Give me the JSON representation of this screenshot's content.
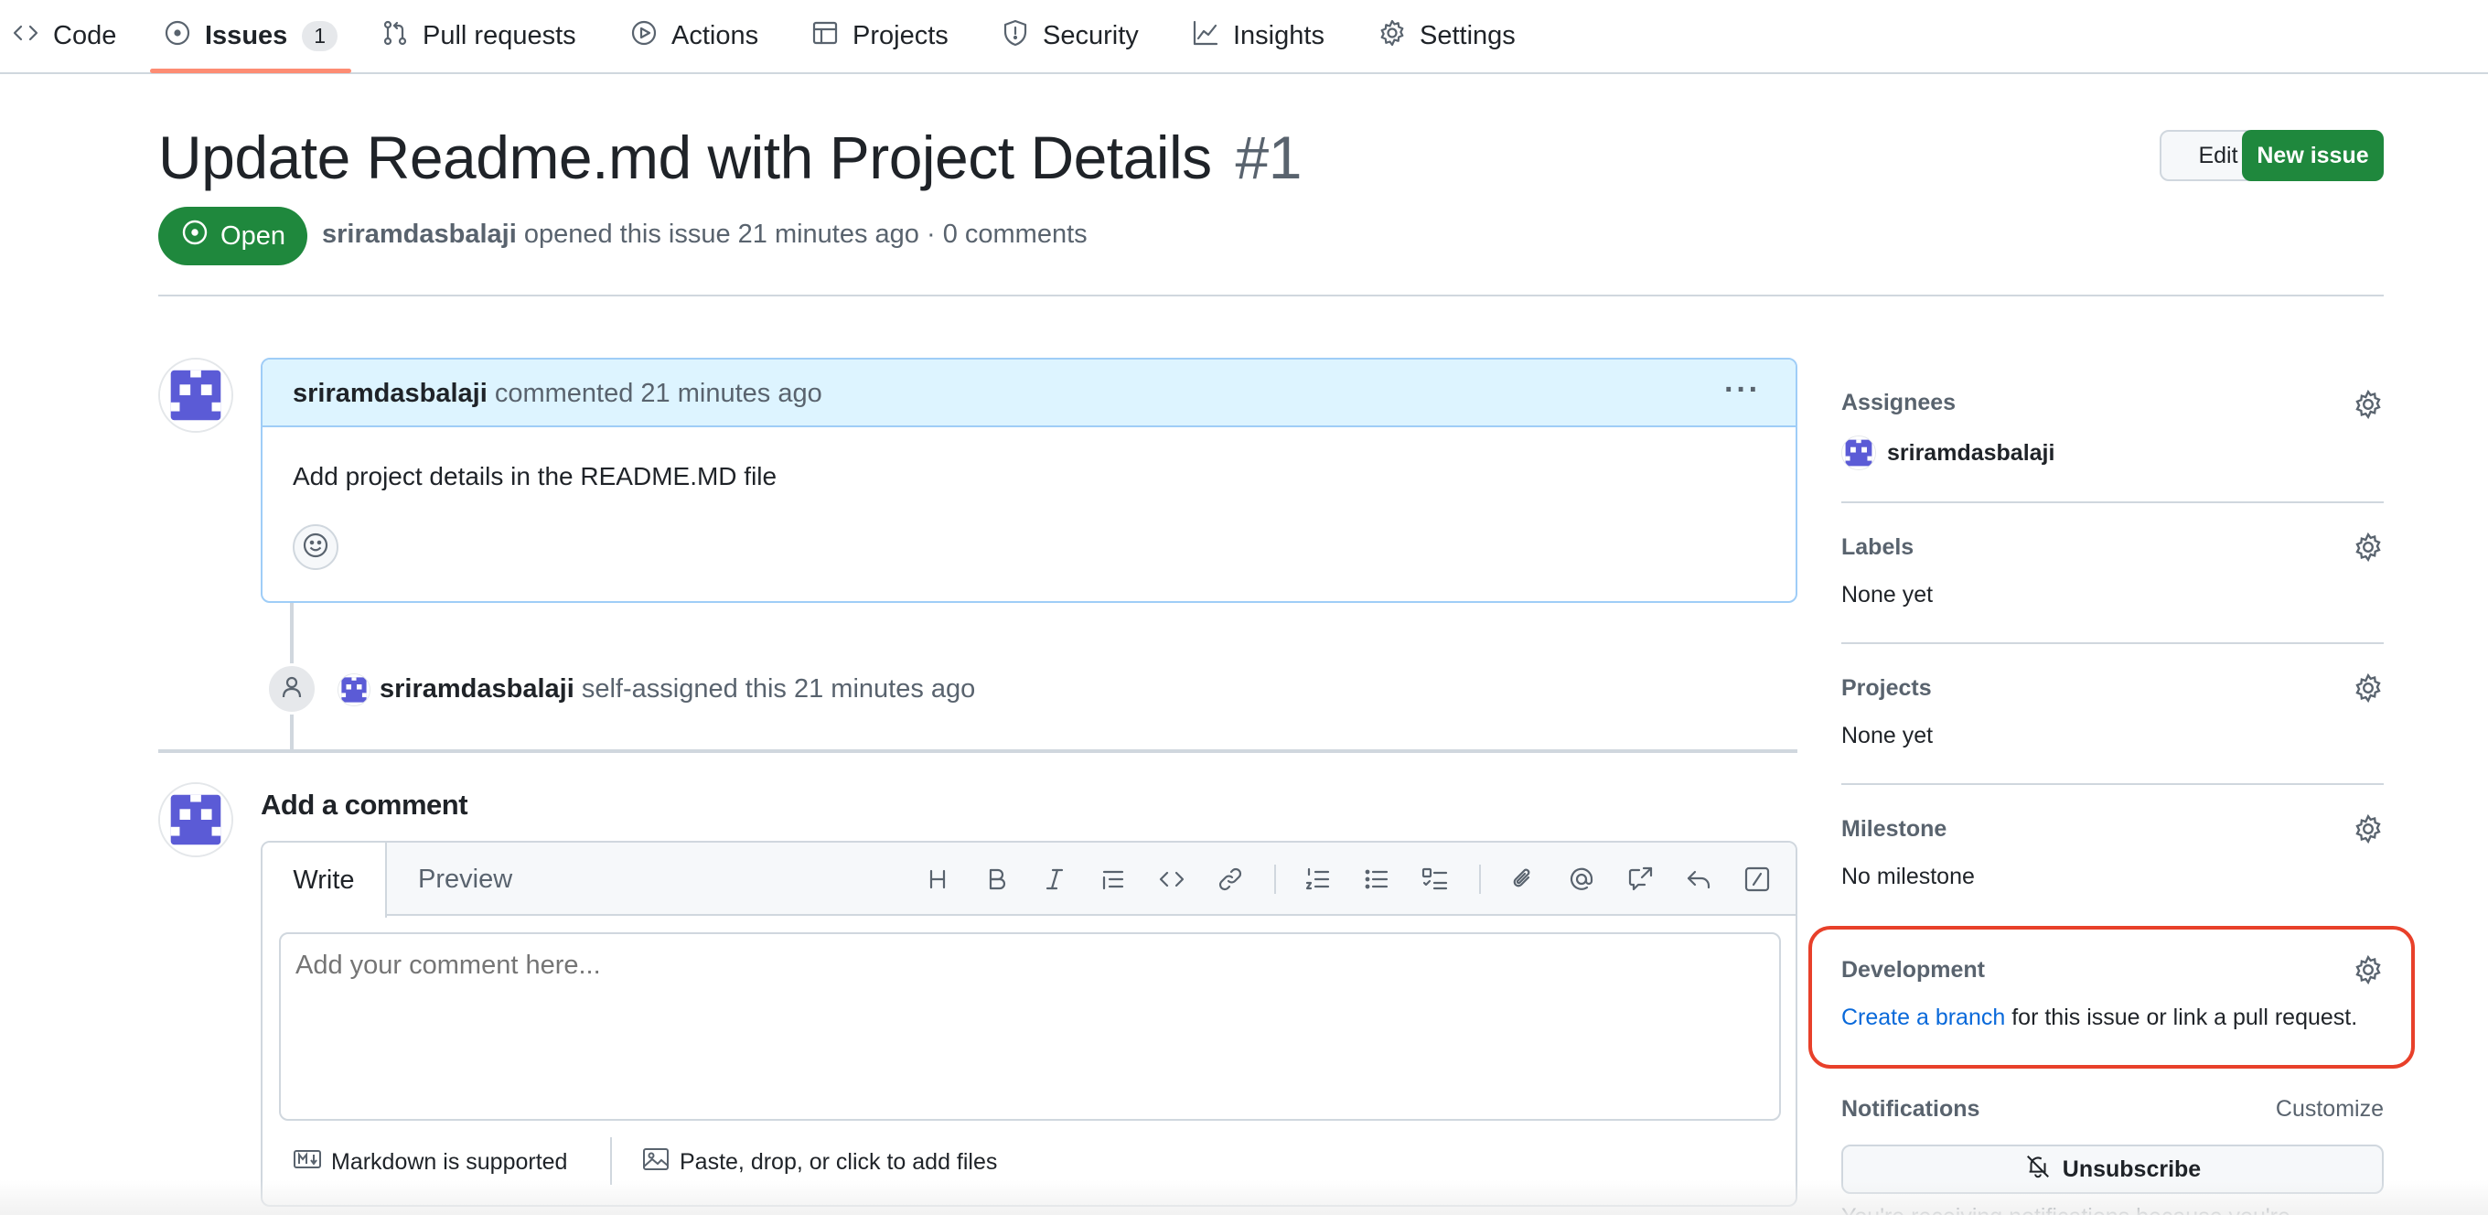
{
  "nav": {
    "tabs": [
      {
        "label": "Code",
        "icon": "code-icon"
      },
      {
        "label": "Issues",
        "icon": "issue-opened-icon",
        "counter": "1",
        "active": true
      },
      {
        "label": "Pull requests",
        "icon": "git-pull-request-icon"
      },
      {
        "label": "Actions",
        "icon": "play-icon"
      },
      {
        "label": "Projects",
        "icon": "table-icon"
      },
      {
        "label": "Security",
        "icon": "shield-icon"
      },
      {
        "label": "Insights",
        "icon": "graph-icon"
      },
      {
        "label": "Settings",
        "icon": "gear-icon"
      }
    ]
  },
  "issue": {
    "title": "Update Readme.md with Project Details",
    "number": "#1",
    "state": "Open",
    "author": "sriramdasbalaji",
    "meta_rest": "opened this issue 21 minutes ago · 0 comments",
    "edit_label": "Edit",
    "new_issue_label": "New issue"
  },
  "comment": {
    "author": "sriramdasbalaji",
    "action": "commented 21 minutes ago",
    "more": "···",
    "body": "Add project details in the README.MD file"
  },
  "event": {
    "actor": "sriramdasbalaji",
    "text": "self-assigned this 21 minutes ago"
  },
  "new_comment": {
    "title": "Add a comment",
    "tab_write": "Write",
    "tab_preview": "Preview",
    "placeholder": "Add your comment here...",
    "markdown_note": "Markdown is supported",
    "files_note": "Paste, drop, or click to add files",
    "toolbar": [
      "heading-icon",
      "bold-icon",
      "italic-icon",
      "quote-icon",
      "code-icon",
      "link-icon",
      "ordered-list-icon",
      "unordered-list-icon",
      "task-list-icon",
      "paperclip-icon",
      "mention-icon",
      "cross-reference-icon",
      "reply-icon",
      "slash-command-icon"
    ]
  },
  "sidebar": {
    "assignees": {
      "heading": "Assignees",
      "user": "sriramdasbalaji"
    },
    "labels": {
      "heading": "Labels",
      "value": "None yet"
    },
    "projects": {
      "heading": "Projects",
      "value": "None yet"
    },
    "milestone": {
      "heading": "Milestone",
      "value": "No milestone"
    },
    "development": {
      "heading": "Development",
      "link": "Create a branch",
      "rest": "for this issue or link a pull request."
    },
    "notifications": {
      "heading": "Notifications",
      "customize": "Customize",
      "unsubscribe": "Unsubscribe",
      "note": "You're receiving notifications because you're"
    }
  },
  "colors": {
    "open_green": "#1f883d",
    "accent_underline": "#fd8c73",
    "link_blue": "#0969da",
    "highlight_red": "#e8402a",
    "comment_header_bg": "#ddf4ff"
  }
}
